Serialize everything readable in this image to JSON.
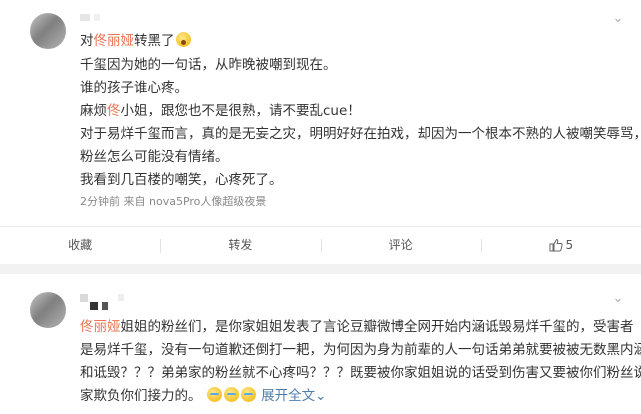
{
  "post1": {
    "prefix": "对",
    "mention": "佟丽娅",
    "suffix": "转黑了",
    "lines": [
      "千玺因为她的一句话，从昨晚被嘲到现在。",
      "谁的孩子谁心疼。",
      "麻烦佟小姐，跟您也不是很熟，请不要乱cue！",
      "对于易烊千玺而言，真的是无妄之灾，明明好好在拍戏，却因为一个根本不熟的人被嘲笑辱骂，",
      "粉丝怎么可能没有情绪。",
      "我看到几百楼的嘲笑，心疼死了。"
    ],
    "line3_highlight": "佟",
    "meta": "2分钟前 来自 nova5Pro人像超级夜景",
    "actions": {
      "favorite": "收藏",
      "repost": "转发",
      "comment": "评论",
      "like_count": "5"
    }
  },
  "post2": {
    "mention": "佟丽娅",
    "lines": [
      "姐姐的粉丝们，是你家姐姐发表了言论豆瓣微博全网开始内涵诋毁易烊千玺的，受害者",
      "是易烊千玺，没有一句道歉还倒打一耙，为何因为身为前辈的人一句话弟弟就要被被无数黑内涵",
      "和诋毁？？？弟弟家的粉丝就不心疼吗？？？既要被你家姐姐说的话受到伤害又要被你们粉丝说我",
      "家欺负你们接力的。"
    ],
    "expand_label": "展开全文",
    "expand_icon": "chevron-down-icon"
  },
  "colors": {
    "mention": "#eb7350",
    "link": "#507daf",
    "meta": "#888888",
    "background": "#f2f2f2"
  }
}
